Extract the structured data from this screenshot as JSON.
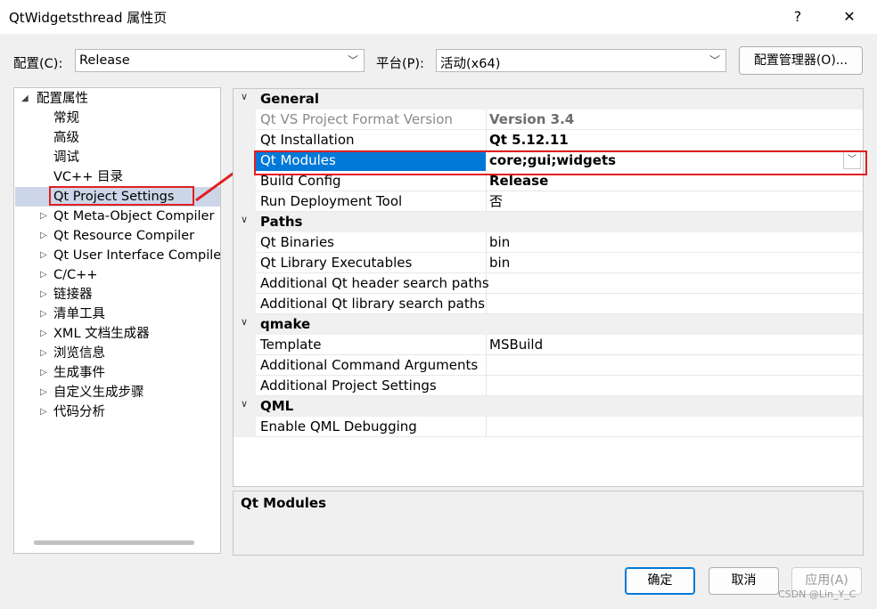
{
  "window": {
    "title": "QtWidgetsthread 属性页",
    "help": "?",
    "close": "✕"
  },
  "config": {
    "label": "配置(C):",
    "value": "Release"
  },
  "platform": {
    "label": "平台(P):",
    "value": "活动(x64)"
  },
  "config_manager": "配置管理器(O)...",
  "tree": {
    "root": "配置属性",
    "items": [
      "常规",
      "高级",
      "调试",
      "VC++ 目录",
      "Qt Project Settings",
      "Qt Meta-Object Compiler",
      "Qt Resource Compiler",
      "Qt User Interface Compiler",
      "C/C++",
      "链接器",
      "清单工具",
      "XML 文档生成器",
      "浏览信息",
      "生成事件",
      "自定义生成步骤",
      "代码分析"
    ]
  },
  "grid": {
    "general": "General",
    "r_format_name": "Qt VS Project Format Version",
    "r_format_val": "Version 3.4",
    "r_install_name": "Qt Installation",
    "r_install_val": "Qt 5.12.11",
    "r_modules_name": "Qt Modules",
    "r_modules_val": "core;gui;widgets",
    "r_build_name": "Build Config",
    "r_build_val": "Release",
    "r_deploy_name": "Run Deployment Tool",
    "r_deploy_val": "否",
    "paths": "Paths",
    "r_bin_name": "Qt Binaries",
    "r_bin_val": "bin",
    "r_libexe_name": "Qt Library Executables",
    "r_libexe_val": "bin",
    "r_hdr_name": "Additional Qt header search paths",
    "r_lib_name": "Additional Qt library search paths",
    "qmake": "qmake",
    "r_tmpl_name": "Template",
    "r_tmpl_val": "MSBuild",
    "r_cmd_name": "Additional Command Arguments",
    "r_proj_name": "Additional Project Settings",
    "qml": "QML",
    "r_qml_name": "Enable QML Debugging"
  },
  "description": {
    "title": "Qt Modules"
  },
  "buttons": {
    "ok": "确定",
    "cancel": "取消",
    "apply": "应用(A)"
  },
  "watermark": "CSDN @Lin_Y_C",
  "colors": {
    "selection": "#0078d7",
    "annotation": "#e02020"
  }
}
